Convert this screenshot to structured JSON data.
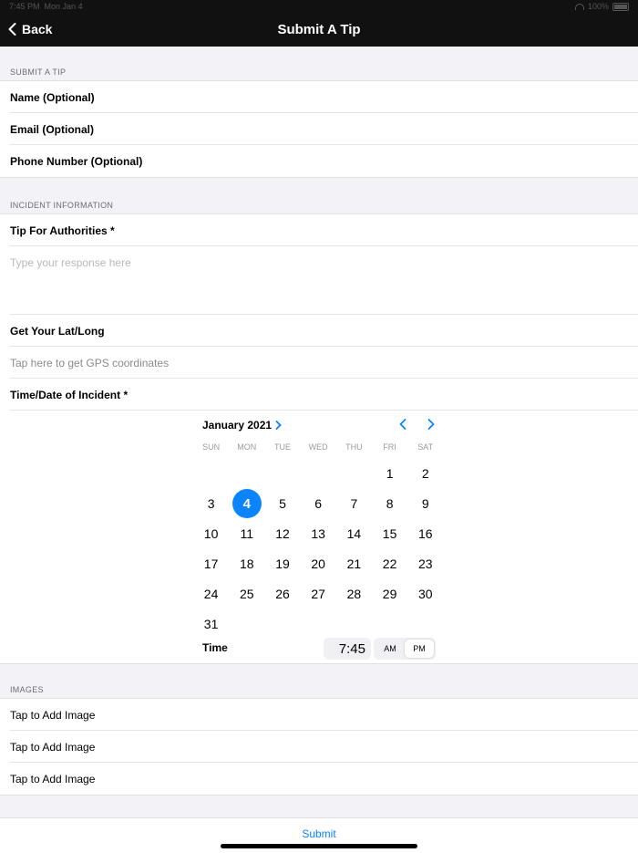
{
  "status": {
    "time": "7:45 PM",
    "date": "Mon Jan 4",
    "battery": "100%"
  },
  "nav": {
    "back_label": "Back",
    "title": "Submit A Tip"
  },
  "sections": {
    "submit": {
      "header": "SUBMIT A TIP",
      "rows": [
        "Name (Optional)",
        "Email (Optional)",
        "Phone Number (Optional)"
      ]
    },
    "incident": {
      "header": "INCIDENT INFORMATION",
      "tip_label": "Tip For Authorities *",
      "tip_placeholder": "Type your response here",
      "latlong_label": "Get Your Lat/Long",
      "latlong_hint": "Tap here to get GPS coordinates",
      "datetime_label": "Time/Date of Incident *"
    },
    "images": {
      "header": "IMAGES",
      "rows": [
        "Tap to Add Image",
        "Tap to Add Image",
        "Tap to Add Image"
      ]
    }
  },
  "calendar": {
    "month_label": "January 2021",
    "weekdays": [
      "SUN",
      "MON",
      "TUE",
      "WED",
      "THU",
      "FRI",
      "SAT"
    ],
    "first_weekday_index": 5,
    "days_in_month": 31,
    "selected_day": 4,
    "accent": "#0a84ff"
  },
  "time": {
    "label": "Time",
    "value": "7:45",
    "am": "AM",
    "pm": "PM",
    "selected": "PM"
  },
  "submit_label": "Submit"
}
